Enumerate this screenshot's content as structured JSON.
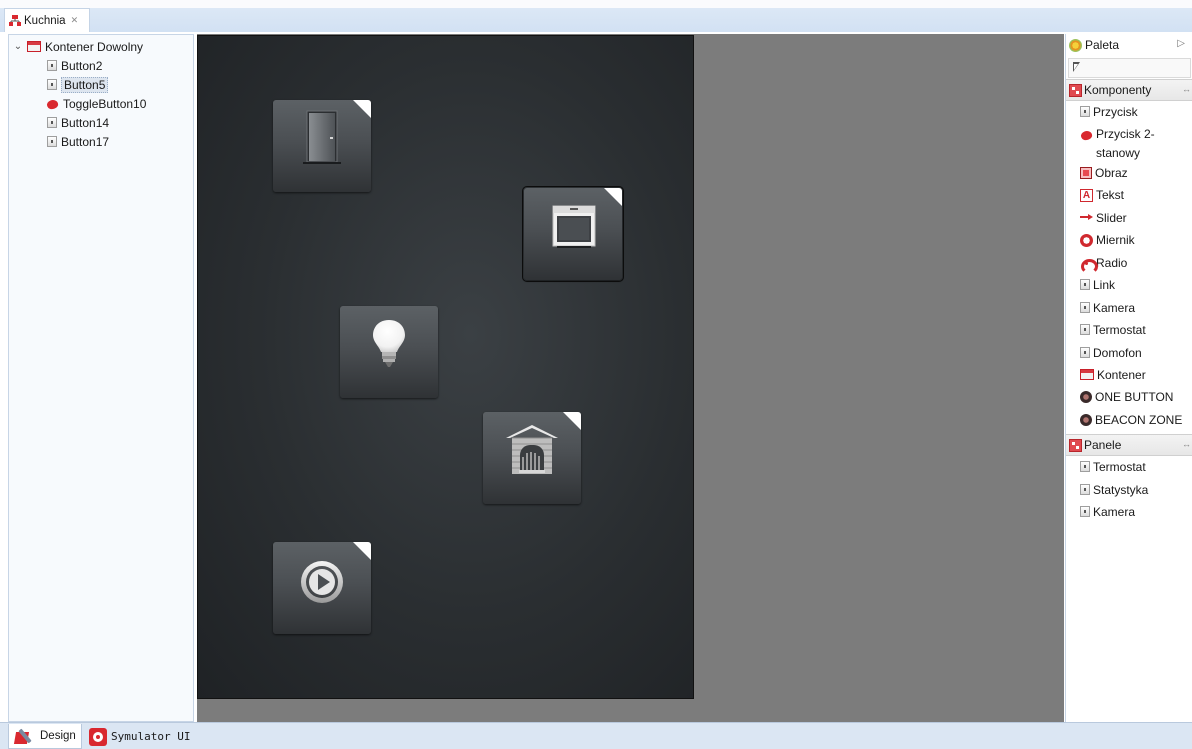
{
  "editor": {
    "tab_title": "Kuchnia",
    "tab_close_glyph": "✕"
  },
  "outline": {
    "root": {
      "label": "Kontener Dowolny",
      "icon": "container-icon",
      "expanded": true
    },
    "items": [
      {
        "label": "Button2",
        "icon": "button-icon",
        "selected": false
      },
      {
        "label": "Button5",
        "icon": "button-icon",
        "selected": true
      },
      {
        "label": "ToggleButton10",
        "icon": "toggle-button-icon",
        "selected": false
      },
      {
        "label": "Button14",
        "icon": "button-icon",
        "selected": false
      },
      {
        "label": "Button17",
        "icon": "button-icon",
        "selected": false
      }
    ]
  },
  "canvas": {
    "widgets": [
      {
        "name": "door-button",
        "icon": "door-icon",
        "selected": false
      },
      {
        "name": "oven-button",
        "icon": "oven-icon",
        "selected": true
      },
      {
        "name": "light-button",
        "icon": "light-bulb-icon",
        "selected": false
      },
      {
        "name": "fireplace-button",
        "icon": "fireplace-icon",
        "selected": false
      },
      {
        "name": "play-button",
        "icon": "play-icon",
        "selected": false
      }
    ]
  },
  "palette": {
    "title": "Paleta",
    "komponenty": {
      "label": "Komponenty",
      "items": [
        {
          "label": "Przycisk",
          "icon": "button-icon"
        },
        {
          "label": "Przycisk 2-\nstanowy",
          "icon": "toggle-button-icon"
        },
        {
          "label": "Obraz",
          "icon": "image-icon"
        },
        {
          "label": "Tekst",
          "icon": "text-icon"
        },
        {
          "label": "Slider",
          "icon": "slider-icon"
        },
        {
          "label": "Miernik",
          "icon": "gauge-icon"
        },
        {
          "label": "Radio",
          "icon": "radio-icon"
        },
        {
          "label": "Link",
          "icon": "button-icon"
        },
        {
          "label": "Kamera",
          "icon": "button-icon"
        },
        {
          "label": "Termostat",
          "icon": "button-icon"
        },
        {
          "label": "Domofon",
          "icon": "button-icon"
        },
        {
          "label": "Kontener",
          "icon": "container-icon"
        },
        {
          "label": "ONE BUTTON",
          "icon": "dot-icon"
        },
        {
          "label": "BEACON ZONE",
          "icon": "dot-icon"
        }
      ]
    },
    "panele": {
      "label": "Panele",
      "items": [
        {
          "label": "Termostat",
          "icon": "button-icon"
        },
        {
          "label": "Statystyka",
          "icon": "button-icon"
        },
        {
          "label": "Kamera",
          "icon": "button-icon"
        }
      ]
    }
  },
  "bottom_tabs": [
    {
      "label": "Design",
      "active": true
    },
    {
      "label": "Symulator UI",
      "active": false
    }
  ]
}
